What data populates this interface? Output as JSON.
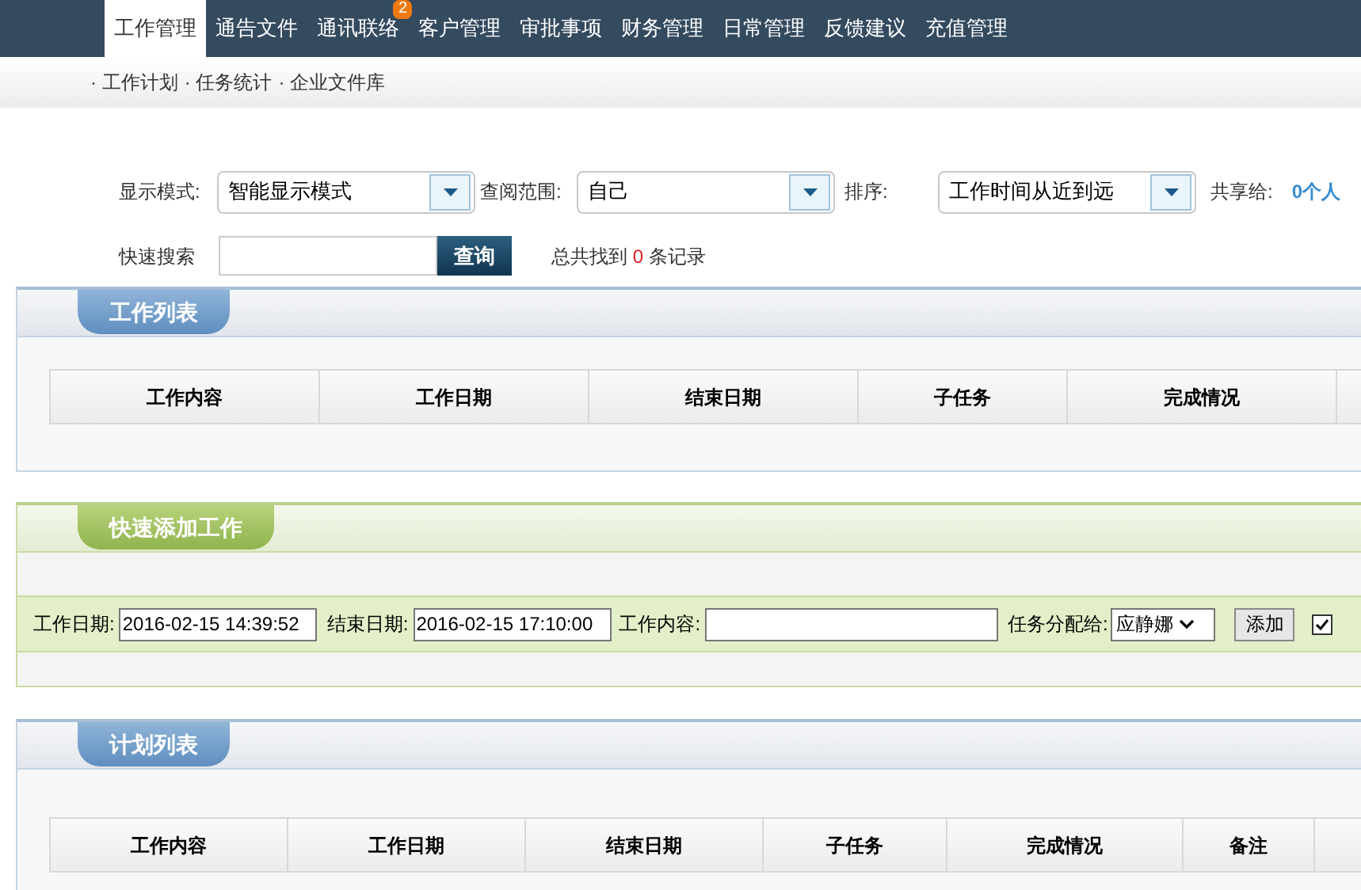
{
  "nav": {
    "items": [
      {
        "label": "工作管理",
        "selected": true
      },
      {
        "label": "通告文件",
        "selected": false
      },
      {
        "label": "通讯联络",
        "selected": false,
        "badge": "2"
      },
      {
        "label": "客户管理",
        "selected": false
      },
      {
        "label": "审批事项",
        "selected": false
      },
      {
        "label": "财务管理",
        "selected": false
      },
      {
        "label": "日常管理",
        "selected": false
      },
      {
        "label": "反馈建议",
        "selected": false
      },
      {
        "label": "充值管理",
        "selected": false
      }
    ]
  },
  "subnav": [
    "· 工作计划",
    "· 任务统计",
    "· 企业文件库"
  ],
  "filters": {
    "display_mode": {
      "label": "显示模式:",
      "value": "智能显示模式"
    },
    "scope": {
      "label": "查阅范围:",
      "value": "自己"
    },
    "sort": {
      "label": "排序:",
      "value": "工作时间从近到远"
    },
    "share": {
      "label": "共享给:",
      "value": "0个人"
    }
  },
  "search": {
    "label": "快速搜索",
    "button": "查询",
    "summary_before": "总共找到",
    "count": "0",
    "summary_after": "条记录"
  },
  "work_list": {
    "title": "工作列表",
    "columns": [
      "工作内容",
      "工作日期",
      "结束日期",
      "子任务",
      "完成情况"
    ]
  },
  "quick_add": {
    "title": "快速添加工作",
    "start_label": "工作日期:",
    "start_value": "2016-02-15 14:39:52",
    "end_label": "结束日期:",
    "end_value": "2016-02-15 17:10:00",
    "content_label": "工作内容:",
    "assign_label": "任务分配给:",
    "assign_value": "应静娜",
    "add_button": "添加",
    "checked": true
  },
  "plan_list": {
    "title": "计划列表",
    "columns": [
      "工作内容",
      "工作日期",
      "结束日期",
      "子任务",
      "完成情况",
      "备注"
    ]
  }
}
